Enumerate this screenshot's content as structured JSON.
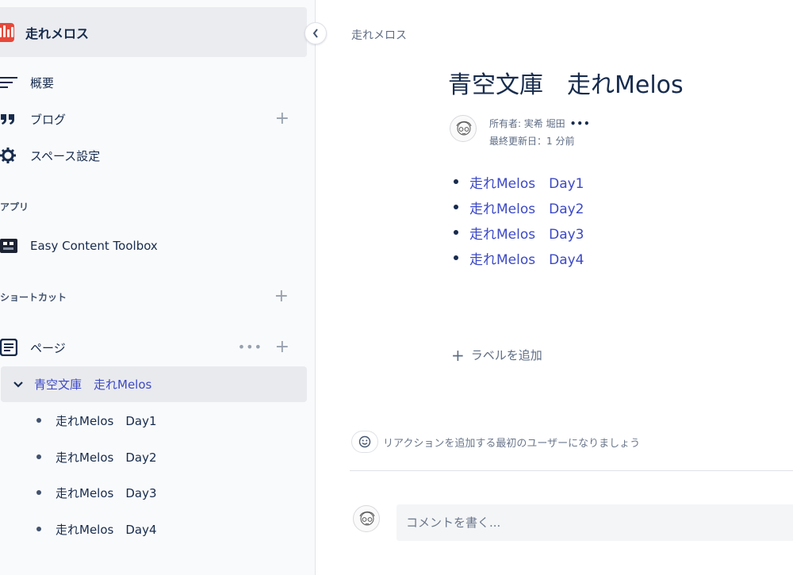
{
  "sidebar": {
    "space_name": "走れメロス",
    "nav": {
      "overview": "概要",
      "blog": "ブログ",
      "space_settings": "スペース設定"
    },
    "apps_heading": "アプリ",
    "apps": [
      {
        "label": "Easy Content Toolbox"
      }
    ],
    "shortcuts_heading": "ショートカット",
    "pages_label": "ページ",
    "tree": {
      "parent": "青空文庫　走れMelos",
      "children": [
        "走れMelos　Day1",
        "走れMelos　Day2",
        "走れMelos　Day3",
        "走れMelos　Day4"
      ]
    }
  },
  "main": {
    "breadcrumb": "走れメロス",
    "title": "青空文庫　走れMelos",
    "byline": {
      "owner": "所有者: 実希 堀田",
      "updated": "最終更新日：1 分前",
      "more": "•••"
    },
    "child_links": [
      "走れMelos　Day1",
      "走れMelos　Day2",
      "走れMelos　Day3",
      "走れMelos　Day4"
    ],
    "add_label": "ラベルを追加",
    "reaction_prompt": "リアクションを追加する最初のユーザーになりましょう",
    "comment_placeholder": "コメントを書く..."
  },
  "colors": {
    "accent_link": "#3c49c6",
    "space_logo": "#e5493a",
    "sidebar_bg": "#f9fafb",
    "selected_bg": "#e9eaee"
  }
}
